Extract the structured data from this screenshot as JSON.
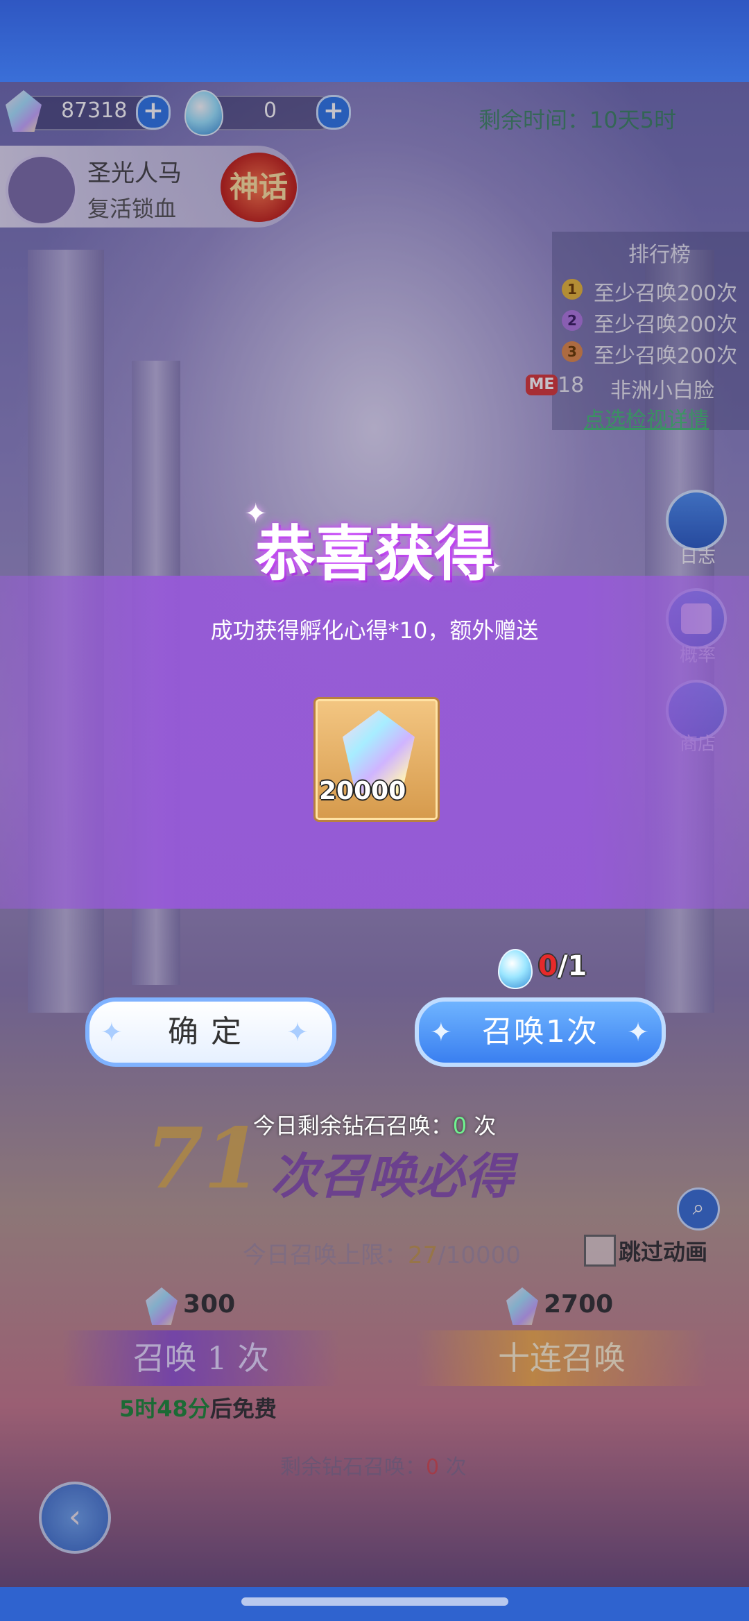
{
  "currency": {
    "crystal": "87318",
    "egg": "0"
  },
  "timer": "剩余时间：10天5时",
  "character": {
    "name": "圣光人马",
    "skill": "复活锁血",
    "badge": "神话"
  },
  "ranking": {
    "title": "排行榜",
    "entries": [
      "至少召唤200次",
      "至少召唤200次",
      "至少召唤200次"
    ],
    "ranks": [
      "1",
      "2",
      "3"
    ],
    "me": {
      "badge": "ME",
      "rank": "18",
      "name": "非洲小白脸"
    },
    "detail": "点选检视详情"
  },
  "side": {
    "log": "日志",
    "prob": "概率",
    "shop": "商店"
  },
  "modal": {
    "title": "恭喜获得",
    "message": "成功获得孵化心得*10，额外赠送",
    "item_count": "20000",
    "egg_cost_have": "0",
    "egg_cost_total": "/1",
    "confirm": "确定",
    "summon_once": "召唤1次",
    "today_remaining_prefix": "今日剩余钻石召唤：",
    "today_remaining_value": "0",
    "today_remaining_suffix": " 次"
  },
  "background": {
    "pity_count": "71",
    "pity_text": "次召唤必得",
    "daily_limit_prefix": "今日召唤上限：",
    "daily_limit_value": "27",
    "daily_limit_total": "/10000",
    "skip_animation": "跳过动画",
    "cost_single": "300",
    "cost_ten": "2700",
    "summon_single": "召唤 1 次",
    "summon_ten": "十连召唤",
    "free_time": "5时48分",
    "free_suffix": "后免费",
    "remain_prefix": "剩余钻石召唤：",
    "remain_value": "0",
    "remain_suffix": " 次"
  },
  "colors": {
    "accent_blue": "#3a7ff0",
    "modal_purple": "#965ad7",
    "title_glow": "#d35cff",
    "green": "#3bd06a"
  }
}
